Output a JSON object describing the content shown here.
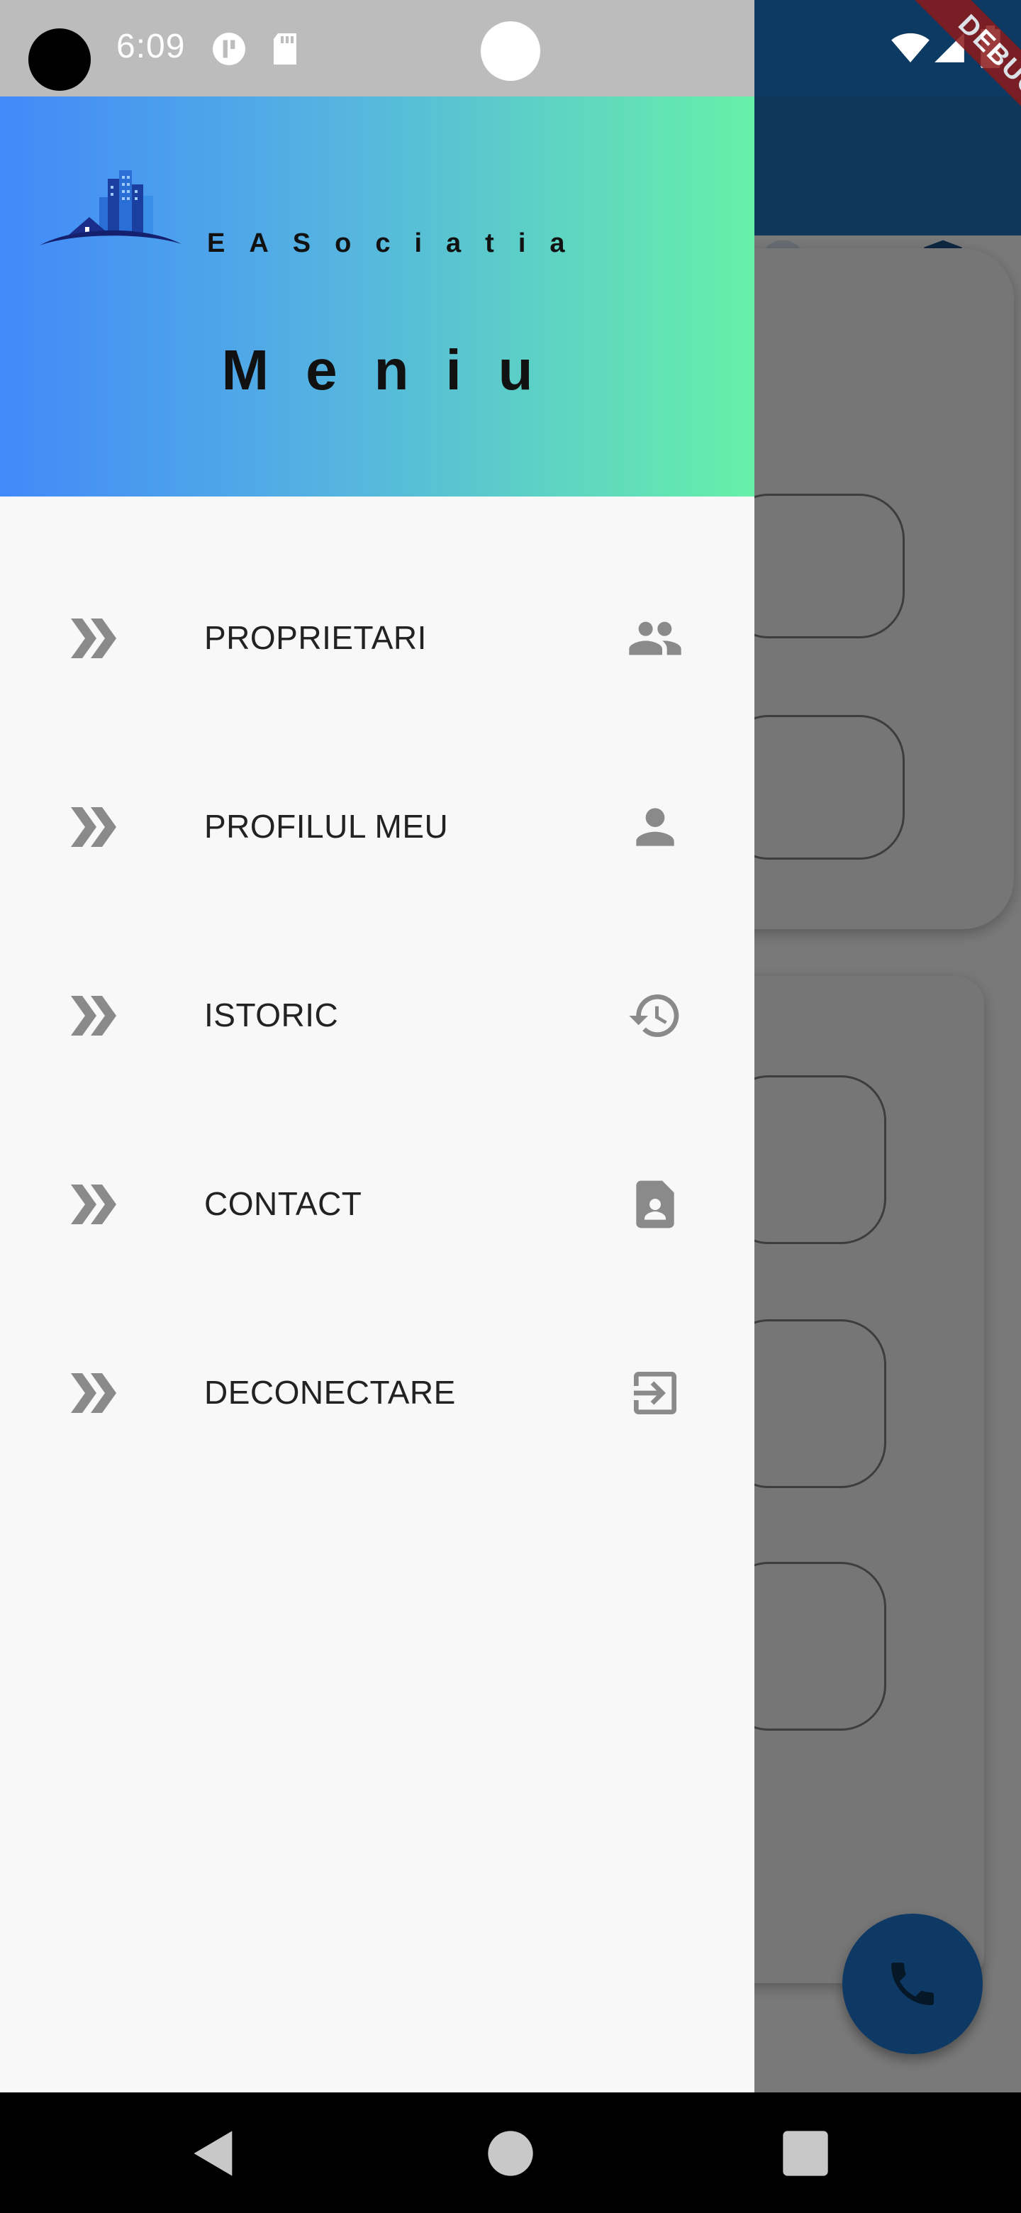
{
  "status_bar": {
    "time": "6:09"
  },
  "debug_banner": "DEBUG",
  "drawer": {
    "brand": "EASociatia",
    "title": "Meniu",
    "items": [
      {
        "label": "PROPRIETARI",
        "icon": "people-icon"
      },
      {
        "label": "PROFILUL MEU",
        "icon": "person-icon"
      },
      {
        "label": "ISTORIC",
        "icon": "history-icon"
      },
      {
        "label": "CONTACT",
        "icon": "contact-card-icon"
      },
      {
        "label": "DECONECTARE",
        "icon": "logout-icon"
      }
    ]
  },
  "colors": {
    "header_gradient_start": "#4289f9",
    "header_gradient_end": "#66f0a8",
    "app_bar": "#1f6fb5",
    "fab": "#1d72c9"
  }
}
